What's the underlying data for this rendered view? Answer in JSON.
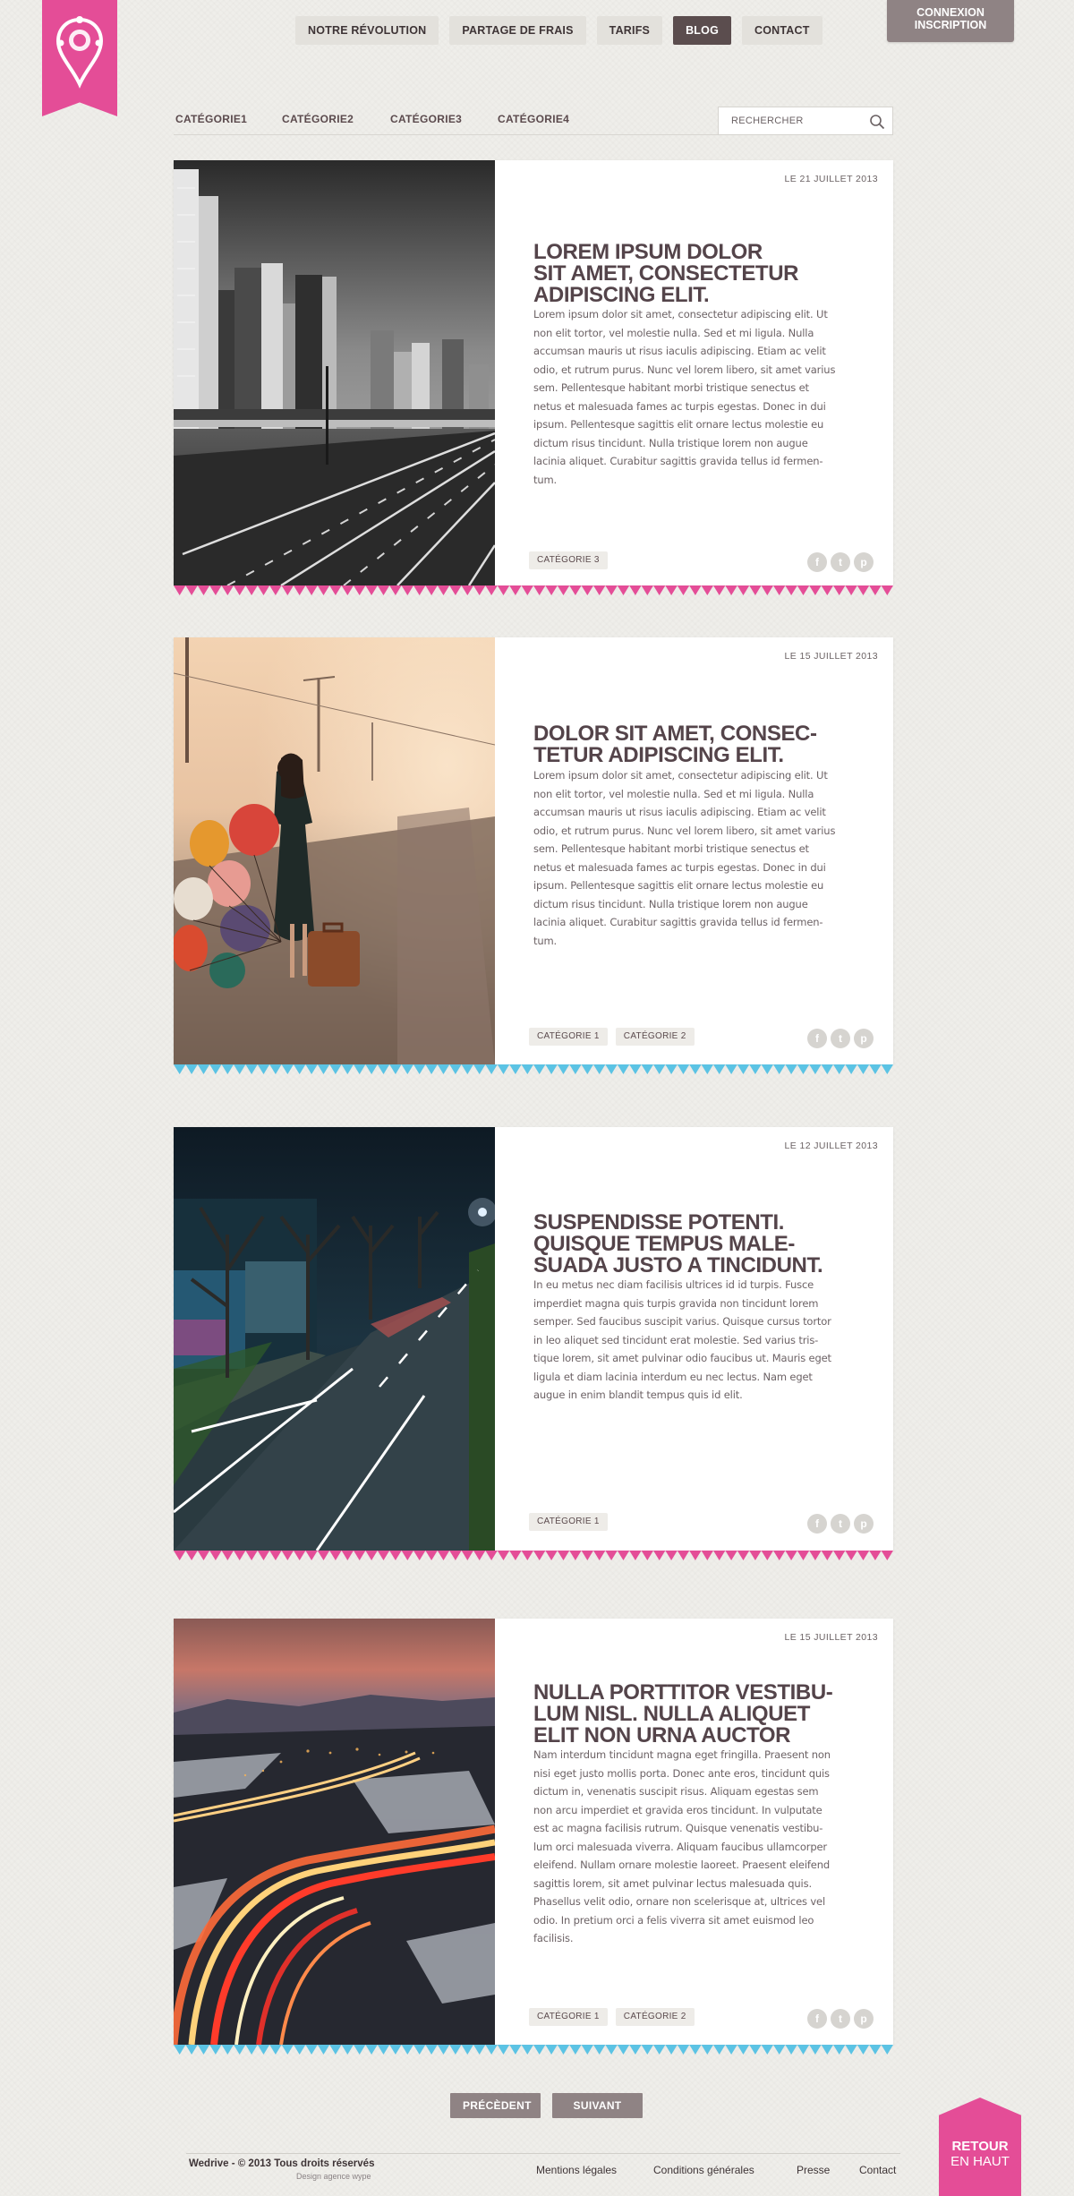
{
  "nav": {
    "items": [
      "NOTRE RÉVOLUTION",
      "PARTAGE DE FRAIS",
      "TARIFS",
      "BLOG",
      "CONTACT"
    ],
    "active": "BLOG"
  },
  "login": {
    "line1": "CONNEXION",
    "line2": "INSCRIPTION"
  },
  "categories": [
    "CATÉGORIE1",
    "CATÉGORIE2",
    "CATÉGORIE3",
    "CATÉGORIE4"
  ],
  "search": {
    "placeholder": "RECHERCHER"
  },
  "posts": [
    {
      "date": "LE 21 JUILLET 2013",
      "title": [
        "LOREM IPSUM DOLOR",
        "SIT AMET, CONSECTETUR",
        "ADIPISCING ELIT."
      ],
      "body": [
        "Lorem ipsum dolor sit amet, consectetur adipiscing elit. Ut",
        "non elit tortor, vel molestie nulla. Sed et mi ligula. Nulla",
        "accumsan mauris ut risus iaculis adipiscing. Etiam ac velit",
        "odio, et rutrum purus. Nunc vel lorem libero, sit amet varius",
        "sem. Pellentesque habitant morbi tristique senectus et",
        "netus et malesuada fames ac turpis egestas. Donec in dui",
        "ipsum. Pellentesque sagittis elit ornare lectus molestie eu",
        "dictum risus tincidunt. Nulla tristique lorem non augue",
        "lacinia aliquet. Curabitur sagittis gravida tellus id fermen-",
        "tum."
      ],
      "tags": [
        "CATÉGORIE 3"
      ],
      "image": "city-highway-photo",
      "accent": "#e44d97"
    },
    {
      "date": "LE 15 JUILLET 2013",
      "title": [
        "DOLOR SIT AMET, CONSEC-",
        "TETUR ADIPISCING ELIT."
      ],
      "body": [
        "Lorem ipsum dolor sit amet, consectetur adipiscing elit. Ut",
        "non elit tortor, vel molestie nulla. Sed et mi ligula. Nulla",
        "accumsan mauris ut risus iaculis adipiscing. Etiam ac velit",
        "odio, et rutrum purus. Nunc vel lorem libero, sit amet varius",
        "sem. Pellentesque habitant morbi tristique senectus et",
        "netus et malesuada fames ac turpis egestas. Donec in dui",
        "ipsum. Pellentesque sagittis elit ornare lectus molestie eu",
        "dictum risus tincidunt. Nulla tristique lorem non augue",
        "lacinia aliquet. Curabitur sagittis gravida tellus id fermen-",
        "tum."
      ],
      "tags": [
        "CATÉGORIE 1",
        "CATÉGORIE 2"
      ],
      "image": "balloons-girl-photo",
      "accent": "#5bc3e4"
    },
    {
      "date": "LE 12 JUILLET 2013",
      "title": [
        "SUSPENDISSE POTENTI.",
        "QUISQUE TEMPUS MALE-",
        "SUADA JUSTO A TINCIDUNT."
      ],
      "body": [
        "In eu metus nec diam facilisis ultrices id id turpis. Fusce",
        "imperdiet magna quis turpis gravida non tincidunt lorem",
        "semper. Sed faucibus suscipit varius. Quisque cursus tortor",
        "in leo aliquet sed tincidunt erat molestie. Sed varius tris-",
        "tique lorem, sit amet pulvinar odio faucibus ut. Mauris eget",
        "ligula et diam lacinia interdum eu nec lectus. Nam eget",
        "augue in enim blandit tempus quis id elit."
      ],
      "tags": [
        "CATÉGORIE 1"
      ],
      "image": "night-street-photo",
      "accent": "#e44d97"
    },
    {
      "date": "LE 15 JUILLET 2013",
      "title": [
        "NULLA PORTTITOR VESTIBU-",
        "LUM NISL. NULLA ALIQUET",
        "ELIT NON URNA AUCTOR"
      ],
      "body": [
        "Nam interdum tincidunt magna eget fringilla. Praesent non",
        "nisi eget justo mollis porta. Donec ante eros, tincidunt quis",
        "dictum in, venenatis suscipit risus. Aliquam egestas sem",
        "non arcu imperdiet et gravida eros tincidunt. In vulputate",
        "est ac magna facilisis rutrum. Quisque venenatis vestibu-",
        "lum orci malesuada viverra. Aliquam faucibus ullamcorper",
        "eleifend. Nullam ornare molestie laoreet. Praesent eleifend",
        "sagittis lorem, sit amet pulvinar lectus malesuada quis.",
        "Phasellus velit odio, ornare non scelerisque at, ultrices vel",
        "odio. In pretium orci a felis viverra sit amet euismod leo",
        "facilisis."
      ],
      "tags": [
        "CATÉGORIE 1",
        "CATÉGORIE 2"
      ],
      "image": "light-trails-photo",
      "accent": "#5bc3e4"
    }
  ],
  "social_icons": [
    "facebook-icon",
    "twitter-icon",
    "pinterest-icon"
  ],
  "pagination": {
    "prev": "PRÉCÈDENT",
    "next": "SUIVANT"
  },
  "footer": {
    "copyright": "Wedrive -  © 2013 Tous droits réservés",
    "credit": "Design agence wype",
    "links": [
      "Mentions légales",
      "Conditions générales",
      "Presse",
      "Contact"
    ]
  },
  "back_to_top": {
    "line1": "RETOUR",
    "line2": "EN HAUT"
  },
  "colors": {
    "brand_pink": "#e44d97",
    "accent_blue": "#5bc3e4",
    "nav_active": "#5b4d4e",
    "button_gray": "#8f8384"
  }
}
